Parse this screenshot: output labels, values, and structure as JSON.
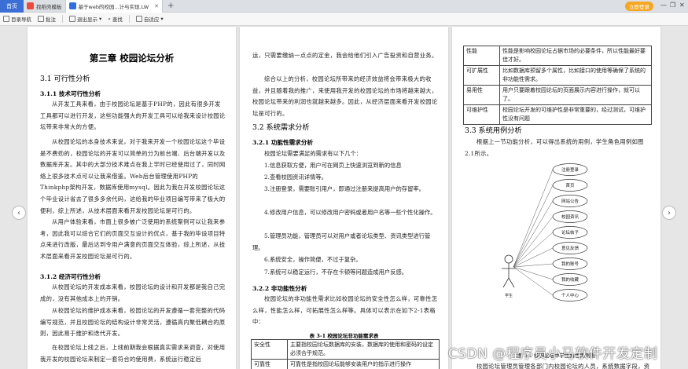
{
  "tabs": {
    "home": "首页",
    "items": [
      {
        "label": "找稻壳模板",
        "color": "#e94b3c"
      },
      {
        "label": "基于web的校园...计与实现.LW",
        "color": "#2f6fe0"
      }
    ],
    "add": "+"
  },
  "login_button": "立即登录",
  "window_controls": {
    "min": "—",
    "restore": "❐",
    "close": "✕"
  },
  "toolbar": {
    "items": [
      "目录导航",
      "批注",
      "退出显示",
      "查找",
      "自适应"
    ]
  },
  "nav": {
    "prev": "‹",
    "next": "›"
  },
  "page1": {
    "chapter_title": "第三章 校园论坛分析",
    "s31": "3.1 可行性分析",
    "s311": "3.1.1 技术可行性分析",
    "p1": "从开发工具来看，由于校园论坛是基于PHP的，因此有很多开发工具都可以进行开发，这些功能强大的开发工具可以给我来设计校园论坛带来非常大的方便。",
    "p2": "从校园论坛的本身技术来说，对于我来开发一个校园论坛这个毕设是不费劲的，校园论坛的开发可以简单的分为前台端、后台端开发以及数据库开发。其中的大部分技术难点在我上学时已经使用过了，同时网络上很多技术点可以让我来借鉴。Web后台管理使用PHP的Thinkphp架构开发，数据库使用mysql。因此为我在开发校园论坛这个毕业设计省去了很多多余代码，这给我的毕业项目编写带来了极大的便利，综上所述，从技术层面来看开发校园论坛是可行的。",
    "p3": "从用户体验来看，市面上很多被广泛使用的系统案例可以让我来参考，因此我可以综合它们的页面交互设计的优点，基于我的毕设项目特点来进行改版，最后达到令用户满意的页面交互体验，综上所述，从技术层面来看开发校园论坛是可行的。",
    "s312": "3.1.2 经济可行性分析",
    "p4": "从校园论坛的开发成本来看，校园论坛的设计和开发都是我自己完成的，没有其他成本上的开销。",
    "p5": "从校园论坛的维护成本来看，校园论坛的开发遵循一套完整的代码编写规范，并且校园论坛的结构设计非常灵活，遵循高内聚低耦合的原则，因此易于维护和迭代开发。",
    "p6": "在校园论坛上线之后，上线前期我会根据真实需求来调查，对使用我开发的校园论坛来制定一套符合的使用费，系统运行稳定后"
  },
  "page2": {
    "p1": "运，只需要缴纳一点点的定金，我会给他们引入广告投资和自营业务。",
    "p2": "综合以上的分析，校园论坛所带来的经济效益将会带来极大的收益，并且随着我的推广，来使用我开发的校园论坛的市场将越来越大，校园论坛带来的利润也就越来越多。因此，从经济层面来看开发校园论坛是可行的。",
    "s32": "3.2 系统需求分析",
    "s321": "3.2.1 功能性需求分析",
    "p3": "校园论坛需要满足的需求有以下几个：",
    "items": [
      "1.信息获取方便，用户可在网页上快速浏览到新的信息",
      "2.查看校园资讯详情等。",
      "3.注册登录，需要账引用户，即通过注册来提高用户的存留率。",
      "4.修改用户信息，可以修改用户密码或者用户名等一些个性化操作。",
      "5.管理员功能，管理员可以对用户或者论坛类型、资讯类型进行管理。",
      "6.系统安全，操作简便，不过于复杂。",
      "7.系统可以稳定运行，不存在卡顿等问题造成用户反感。"
    ],
    "s322": "3.2.2 非功能性分析",
    "p4": "校园论坛的非功能性需求比如校园论坛的安全性怎么样，可靠性怎么样，性能怎么样，可拓展性怎么样等。具体可以表示在如下2-1表格中：",
    "table_caption": "表 3-1 校园论坛非功能需求表",
    "table": [
      {
        "k": "安全性",
        "v": "主要指校园论坛数据库的安装，数据库的使用和密码的设定必须合乎规范。"
      },
      {
        "k": "可靠性",
        "v": "可靠性是指校园论坛能够安装用户的指示进行操作"
      }
    ]
  },
  "page3": {
    "table": [
      {
        "k": "性能",
        "v": "性能是影响校园论坛占据市场的必要条件，所以性能最好要佳才好。"
      },
      {
        "k": "可扩展性",
        "v": "比如数据库预留多个属性，比如接口的使用等确保了系统的非功能性需求。"
      },
      {
        "k": "易用性",
        "v": "用户只要跟着校园论坛的页面展示内容进行操作，就可以了。"
      },
      {
        "k": "可维护性",
        "v": "校园论坛开发的可维护性是非常重要的，经过测试，可维护性没有问题"
      }
    ],
    "s33": "3.3 系统用例分析",
    "p1": "根据上一节功能分析，可以得出系统的用例，学生角色用例如图2.1所示。",
    "actor": "学生",
    "use_cases": [
      "注册登录",
      "首页",
      "网站公告",
      "校园资讯",
      "论坛帖子",
      "意见反馈",
      "我的账号",
      "我的收藏",
      "个人中心"
    ],
    "figure_caption": "图 3.1 校园论坛中学生角色用例图",
    "p2": "校园论坛管理员管理各部门内校园论坛的人员，系统数据字段，资讯"
  },
  "watermark": "CSDN @程序员小马软件开发定制"
}
